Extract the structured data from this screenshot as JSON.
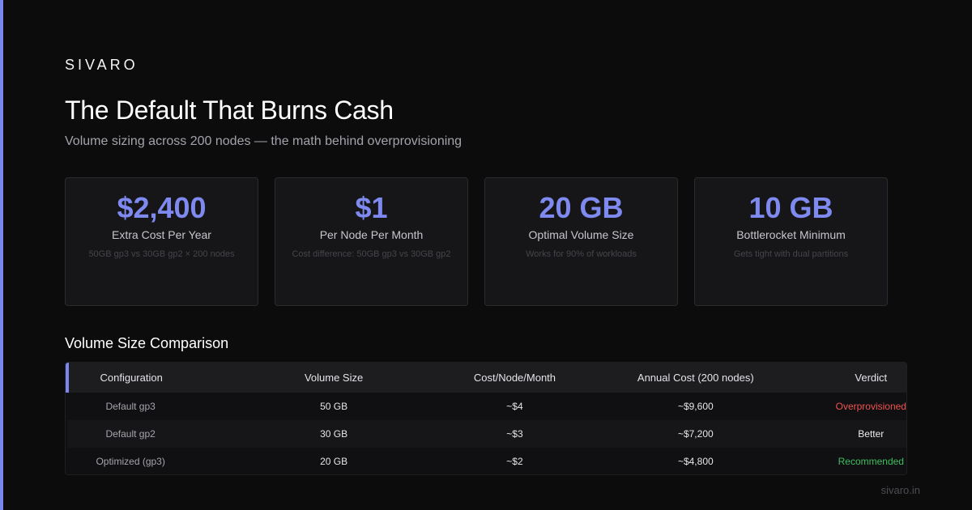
{
  "brand": "SIVARO",
  "title": "The Default That Burns Cash",
  "subtitle": "Volume sizing across 200 nodes — the math behind overprovisioning",
  "cards": [
    {
      "value": "$2,400",
      "label": "Extra Cost Per Year",
      "note": "50GB gp3 vs 30GB gp2 × 200 nodes"
    },
    {
      "value": "$1",
      "label": "Per Node Per Month",
      "note": "Cost difference: 50GB gp3 vs 30GB gp2"
    },
    {
      "value": "20 GB",
      "label": "Optimal Volume Size",
      "note": "Works for 90% of workloads"
    },
    {
      "value": "10 GB",
      "label": "Bottlerocket Minimum",
      "note": "Gets tight with dual partitions"
    }
  ],
  "comparison": {
    "title": "Volume Size Comparison",
    "headers": [
      "Configuration",
      "Volume Size",
      "Cost/Node/Month",
      "Annual Cost (200 nodes)",
      "Verdict"
    ],
    "rows": [
      {
        "config": "Default gp3",
        "size": "50 GB",
        "monthly": "~$4",
        "annual": "~$9,600",
        "verdict": "Overprovisioned"
      },
      {
        "config": "Default gp2",
        "size": "30 GB",
        "monthly": "~$3",
        "annual": "~$7,200",
        "verdict": "Better"
      },
      {
        "config": "Optimized (gp3)",
        "size": "20 GB",
        "monthly": "~$2",
        "annual": "~$4,800",
        "verdict": "Recommended"
      }
    ]
  },
  "colors": {
    "accent": "#7b86ec",
    "overprovisioned": "#ef5350",
    "recommended": "#3fbf5f"
  },
  "footer": "sivaro.in"
}
